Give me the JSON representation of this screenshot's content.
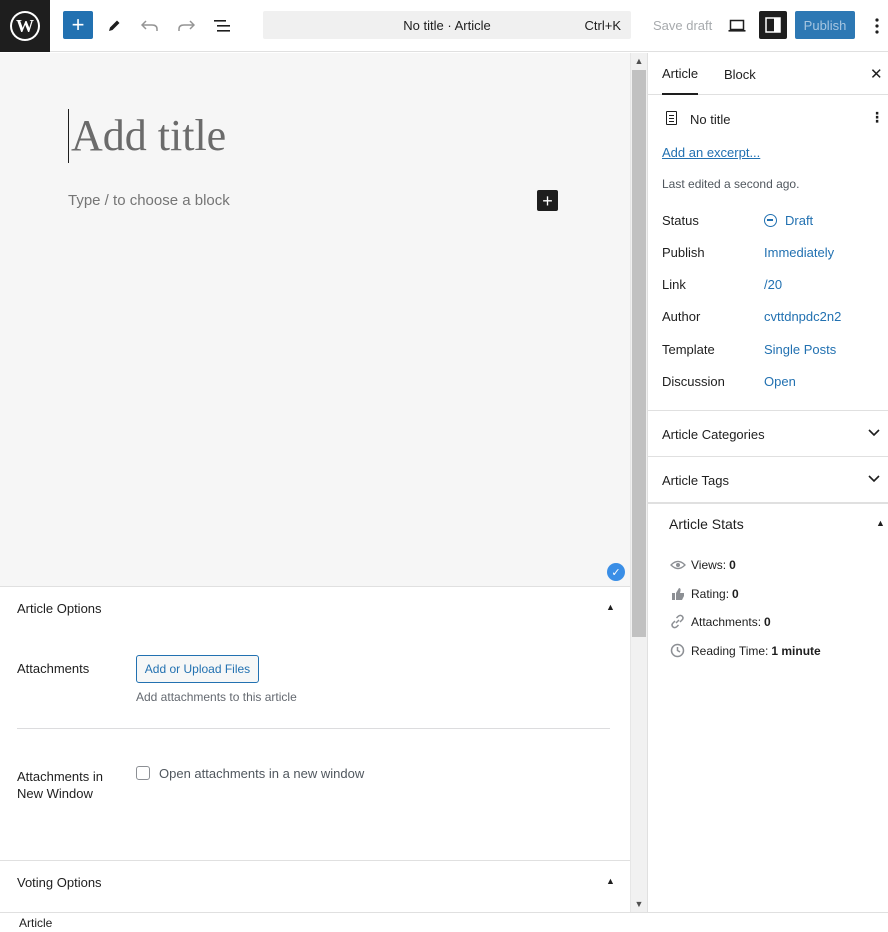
{
  "toolbar": {
    "logo_letter": "W",
    "add_label": "+",
    "command_title": "No title · Article",
    "command_shortcut": "Ctrl+K",
    "save_draft": "Save draft",
    "publish": "Publish"
  },
  "editor": {
    "title_placeholder": "Add title",
    "block_placeholder": "Type / to choose a block",
    "add_block_label": "+"
  },
  "metaboxes": {
    "article_options": {
      "title": "Article Options",
      "attachments_label": "Attachments",
      "upload_button": "Add or Upload Files",
      "attachments_desc": "Add attachments to this article",
      "new_window_label_line1": "Attachments in",
      "new_window_label_line2": "New Window",
      "new_window_checkbox_label": "Open attachments in a new window",
      "new_window_checked": false
    },
    "voting_options": {
      "title": "Voting Options"
    }
  },
  "sidebar": {
    "tabs": [
      {
        "label": "Article",
        "active": true
      },
      {
        "label": "Block",
        "active": false
      }
    ],
    "doc_title": "No title",
    "excerpt_link": "Add an excerpt...",
    "last_edited": "Last edited a second ago.",
    "rows": [
      {
        "label": "Status",
        "value": "Draft"
      },
      {
        "label": "Publish",
        "value": "Immediately"
      },
      {
        "label": "Link",
        "value": "/20"
      },
      {
        "label": "Author",
        "value": "cvttdnpdc2n2"
      },
      {
        "label": "Template",
        "value": "Single Posts"
      },
      {
        "label": "Discussion",
        "value": "Open"
      }
    ],
    "panels": [
      {
        "title": "Article Categories"
      },
      {
        "title": "Article Tags"
      }
    ],
    "stats": {
      "title": "Article Stats",
      "items": [
        {
          "label": "Views:",
          "value": "0",
          "icon": "eye-icon"
        },
        {
          "label": "Rating:",
          "value": "0",
          "icon": "thumbs-up-icon"
        },
        {
          "label": "Attachments:",
          "value": "0",
          "icon": "link-icon"
        },
        {
          "label": "Reading Time:",
          "value": "1 minute",
          "icon": "clock-icon"
        }
      ]
    }
  },
  "footer": {
    "breadcrumb": "Article"
  },
  "colors": {
    "accent": "#2271b1",
    "dark": "#1e1e1e",
    "canvas_bg": "#f6f6f6"
  }
}
